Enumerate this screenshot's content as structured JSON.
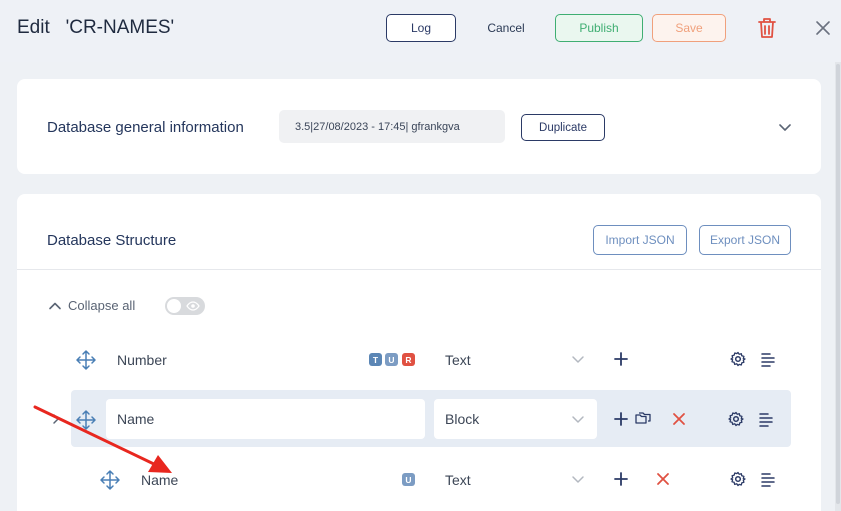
{
  "header": {
    "edit_label": "Edit",
    "db_name": "'CR-NAMES'",
    "log_label": "Log",
    "cancel_label": "Cancel",
    "publish_label": "Publish",
    "save_label": "Save"
  },
  "general": {
    "title": "Database general information",
    "version_info": "3.5|27/08/2023 - 17:45| gfrankgva",
    "duplicate_label": "Duplicate"
  },
  "structure": {
    "title": "Database Structure",
    "import_label": "Import JSON",
    "export_label": "Export JSON",
    "collapse_label": "Collapse all",
    "rows": [
      {
        "name": "Number",
        "type": "Text",
        "badges": [
          "T",
          "U",
          "R"
        ]
      },
      {
        "name": "Name",
        "type": "Block"
      },
      {
        "name": "Name",
        "type": "Text",
        "badges": [
          "U"
        ]
      }
    ]
  },
  "colors": {
    "accent": "#2b3a66",
    "publish": "#3fae72",
    "save": "#f0a07c",
    "danger": "#e05142",
    "annotation_arrow": "#e8271f"
  }
}
